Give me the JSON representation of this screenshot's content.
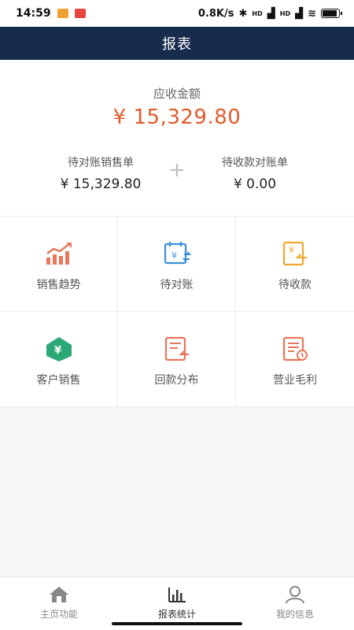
{
  "status_bar": {
    "time": "14:59",
    "network_speed": "0.8K/s",
    "signal_tag_1": "HD",
    "signal_tag_2": "HD"
  },
  "header": {
    "title": "报表"
  },
  "summary": {
    "receivable_label": "应收金额",
    "receivable_amount": "¥ 15,329.80",
    "pending_sales_label": "待对账销售单",
    "pending_sales_value": "¥ 15,329.80",
    "plus_sign": "+",
    "pending_statement_label": "待收款对账单",
    "pending_statement_value": "¥ 0.00"
  },
  "grid": {
    "items": [
      {
        "label": "销售趋势",
        "icon": "trend-chart-icon",
        "color": "#e8765a"
      },
      {
        "label": "待对账",
        "icon": "reconcile-icon",
        "color": "#3a8fd6"
      },
      {
        "label": "待收款",
        "icon": "receivable-icon",
        "color": "#f0a830"
      },
      {
        "label": "客户销售",
        "icon": "customer-sales-icon",
        "color": "#2aa876"
      },
      {
        "label": "回款分布",
        "icon": "payback-distribution-icon",
        "color": "#e8765a"
      },
      {
        "label": "营业毛利",
        "icon": "gross-profit-icon",
        "color": "#e8765a"
      }
    ]
  },
  "bottom_nav": {
    "items": [
      {
        "label": "主页功能",
        "icon": "home-icon",
        "active": false
      },
      {
        "label": "报表统计",
        "icon": "bar-chart-icon",
        "active": true
      },
      {
        "label": "我的信息",
        "icon": "user-icon",
        "active": false
      }
    ]
  },
  "colors": {
    "header_bg": "#172b4d",
    "accent_amount": "#e05a2a"
  }
}
